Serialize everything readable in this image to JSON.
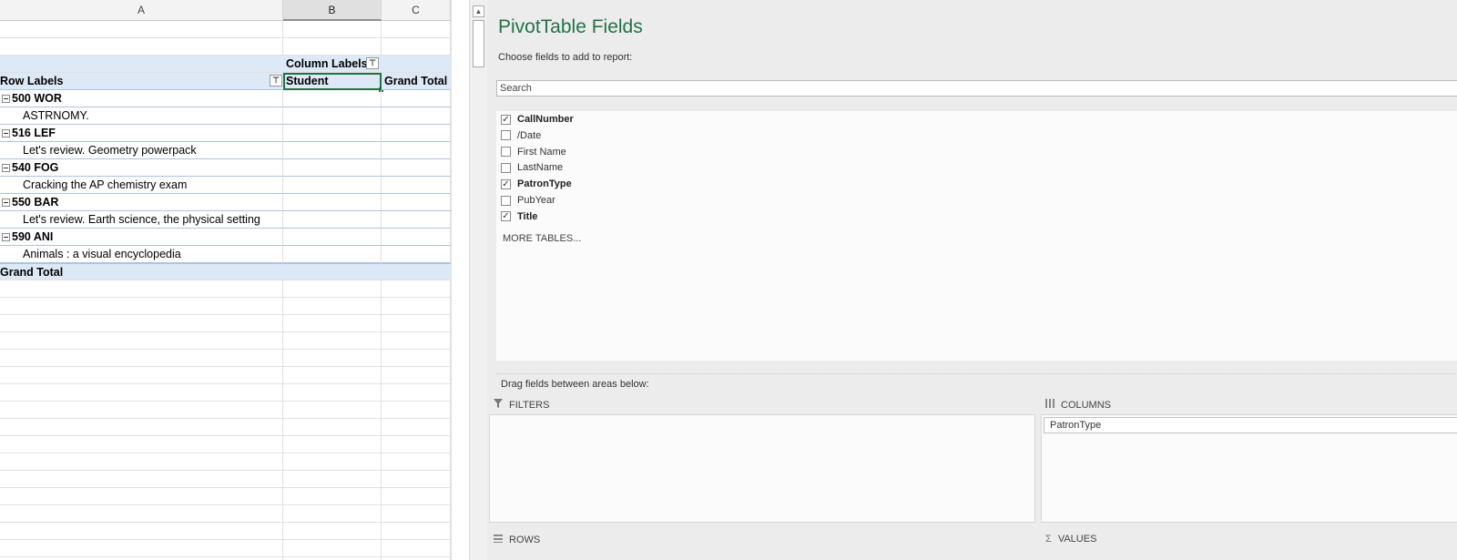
{
  "sheet": {
    "columns": [
      "A",
      "B",
      "C"
    ],
    "column_labels_header": "Column Labels",
    "row_labels_header": "Row Labels",
    "column_field_value": "Student",
    "grand_total_col": "Grand Total",
    "groups": [
      {
        "call_number": "500 WOR",
        "title": "ASTRNOMY."
      },
      {
        "call_number": "516 LEF",
        "title": "Let's review. Geometry powerpack"
      },
      {
        "call_number": "540 FOG",
        "title": "Cracking the AP chemistry exam"
      },
      {
        "call_number": "550 BAR",
        "title": "Let's review. Earth science, the physical setting"
      },
      {
        "call_number": "590 ANI",
        "title": "Animals : a visual encyclopedia"
      }
    ],
    "grand_total_row": "Grand Total"
  },
  "pane": {
    "title": "PivotTable Fields",
    "choose_label": "Choose fields to add to report:",
    "search_placeholder": "Search",
    "fields": [
      {
        "name": "CallNumber",
        "checked": true
      },
      {
        "name": "/Date",
        "checked": false
      },
      {
        "name": "First Name",
        "checked": false
      },
      {
        "name": "LastName",
        "checked": false
      },
      {
        "name": "PatronType",
        "checked": true
      },
      {
        "name": "PubYear",
        "checked": false
      },
      {
        "name": "Title",
        "checked": true
      }
    ],
    "more_tables": "MORE TABLES...",
    "drag_label": "Drag fields between areas below:",
    "areas": {
      "filters": {
        "label": "FILTERS",
        "icon": "filter-icon",
        "items": []
      },
      "columns": {
        "label": "COLUMNS",
        "icon": "columns-icon",
        "items": [
          "PatronType"
        ]
      },
      "rows": {
        "label": "ROWS",
        "icon": "rows-icon",
        "items": []
      },
      "values": {
        "label": "VALUES",
        "icon": "sigma-icon",
        "items": []
      }
    }
  },
  "colors": {
    "accent": "#217346",
    "pivot_fill": "#dde9f6"
  }
}
